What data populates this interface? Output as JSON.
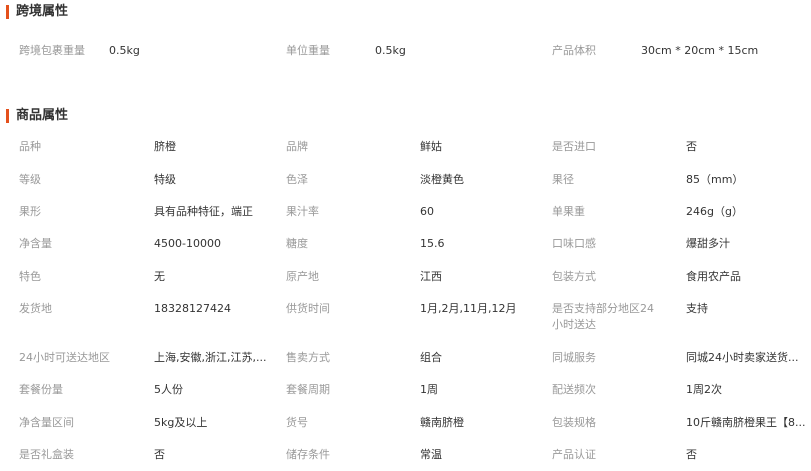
{
  "cross_border": {
    "title": "跨境属性",
    "items": [
      {
        "label": "跨境包裹重量",
        "value": "0.5kg"
      },
      {
        "label": "单位重量",
        "value": "0.5kg"
      },
      {
        "label": "产品体积",
        "value": "30cm * 20cm * 15cm"
      }
    ]
  },
  "product": {
    "title": "商品属性",
    "rows": [
      [
        {
          "label": "品种",
          "value": "脐橙"
        },
        {
          "label": "品牌",
          "value": "鲜姑"
        },
        {
          "label": "是否进口",
          "value": "否"
        }
      ],
      [
        {
          "label": "等级",
          "value": "特级"
        },
        {
          "label": "色泽",
          "value": "淡橙黄色"
        },
        {
          "label": "果径",
          "value": "85（mm）"
        }
      ],
      [
        {
          "label": "果形",
          "value": "具有品种特征，端正"
        },
        {
          "label": "果汁率",
          "value": "60"
        },
        {
          "label": "单果重",
          "value": "246g（g）"
        }
      ],
      [
        {
          "label": "净含量",
          "value": "4500-10000"
        },
        {
          "label": "糖度",
          "value": "15.6"
        },
        {
          "label": "口味口感",
          "value": "爆甜多汁"
        }
      ],
      [
        {
          "label": "特色",
          "value": "无"
        },
        {
          "label": "原产地",
          "value": "江西"
        },
        {
          "label": "包装方式",
          "value": "食用农产品"
        }
      ],
      [
        {
          "label": "发货地",
          "value": "18328127424"
        },
        {
          "label": "供货时间",
          "value": "1月,2月,11月,12月"
        },
        {
          "label": "是否支持部分地区24小时送达",
          "value": "支持"
        }
      ],
      [
        {
          "label": "24小时可送达地区",
          "value": "上海,安徽,浙江,江苏,..."
        },
        {
          "label": "售卖方式",
          "value": "组合"
        },
        {
          "label": "同城服务",
          "value": "同城24小时卖家送货..."
        }
      ],
      [
        {
          "label": "套餐份量",
          "value": "5人份"
        },
        {
          "label": "套餐周期",
          "value": "1周"
        },
        {
          "label": "配送频次",
          "value": "1周2次"
        }
      ],
      [
        {
          "label": "净含量区间",
          "value": "5kg及以上"
        },
        {
          "label": "货号",
          "value": "赣南脐橙"
        },
        {
          "label": "包装规格",
          "value": "10斤赣南脐橙果王【8..."
        }
      ],
      [
        {
          "label": "是否礼盒装",
          "value": "否"
        },
        {
          "label": "储存条件",
          "value": "常温"
        },
        {
          "label": "产品认证",
          "value": "否"
        }
      ]
    ]
  },
  "colors": {
    "accent_bar": "#e4501c",
    "label": "#999999",
    "value": "#333333"
  }
}
